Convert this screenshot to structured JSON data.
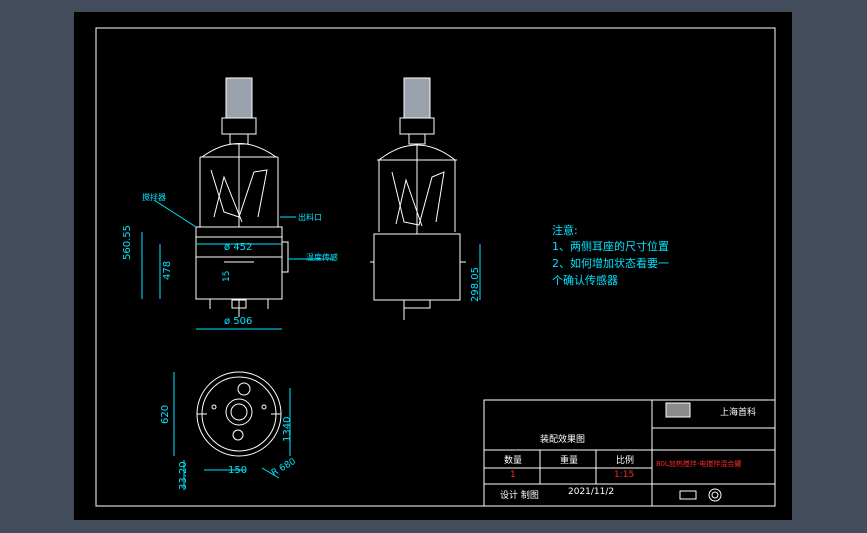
{
  "drawing": {
    "dimensions": {
      "inner_diameter": "ø 452",
      "outer_diameter": "ø 506",
      "overall_height": "560.55",
      "body_height": "478",
      "small_height": "15",
      "side_height": "298.05",
      "plan_height": "620",
      "plan_side": "1340",
      "plan_bottom": "33.20",
      "plan_width": "150",
      "plan_radius": "R 680"
    },
    "callouts": {
      "left_upper": "搅拌器",
      "right_upper": "出料口",
      "right_lower": "温度传感"
    },
    "notes": {
      "title": "注意:",
      "line1": "1、两侧耳座的尺寸位置",
      "line2": "2、如何增加状态看要一",
      "line3": "个确认传感器"
    }
  },
  "title_block": {
    "company": "上海首科",
    "drawing_name": "装配效果图",
    "col_qty": "数量",
    "col_weight": "重量",
    "col_scale": "比例",
    "qty_value": "1",
    "scale_value": "1:15",
    "product_name": "80L加热搅拌-电搅拌混合罐",
    "footer_label": "设计  制图",
    "date": "2021/11/2"
  },
  "colors": {
    "background": "#424c5a",
    "sheet": "#000000",
    "lines": "#ffffff",
    "dimension": "#00e5ff",
    "highlight": "#ff2a2a",
    "motor": "#9aa3ad"
  }
}
